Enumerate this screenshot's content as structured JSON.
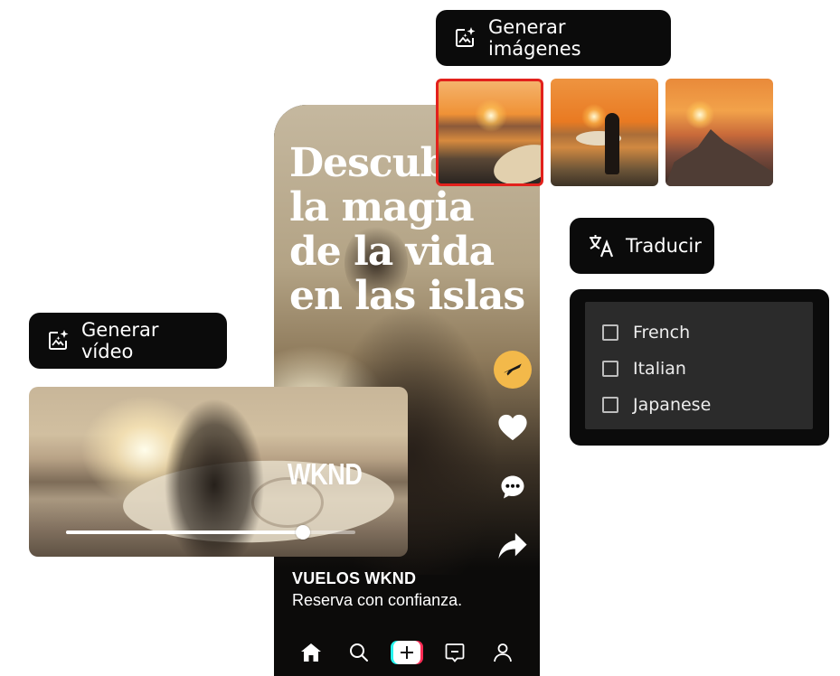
{
  "phone": {
    "headline_lines": [
      "Descubre",
      "la magia",
      "de la vida",
      "en las islas"
    ],
    "brand_name": "VUELOS WKND",
    "tagline": "Reserva con confianza.",
    "actions": [
      "airplane-icon",
      "heart-icon",
      "comment-icon",
      "share-icon"
    ],
    "nav": [
      "home-icon",
      "search-icon",
      "create-icon",
      "inbox-icon",
      "profile-icon"
    ]
  },
  "generate_images": {
    "label": "Generar imágenes",
    "icon": "sparkle-image-icon",
    "selected_index": 0
  },
  "translate": {
    "label": "Traducir",
    "icon": "translate-icon",
    "languages": [
      {
        "label": "French",
        "checked": false
      },
      {
        "label": "Italian",
        "checked": false
      },
      {
        "label": "Japanese",
        "checked": false
      }
    ]
  },
  "generate_video": {
    "label": "Generar vídeo",
    "icon": "sparkle-image-icon"
  },
  "video": {
    "title": "WKND",
    "progress": 0.82
  },
  "colors": {
    "accent_yellow": "#f3b94a",
    "selected_border": "#e2211c",
    "panel_bg": "#0b0b0b"
  }
}
